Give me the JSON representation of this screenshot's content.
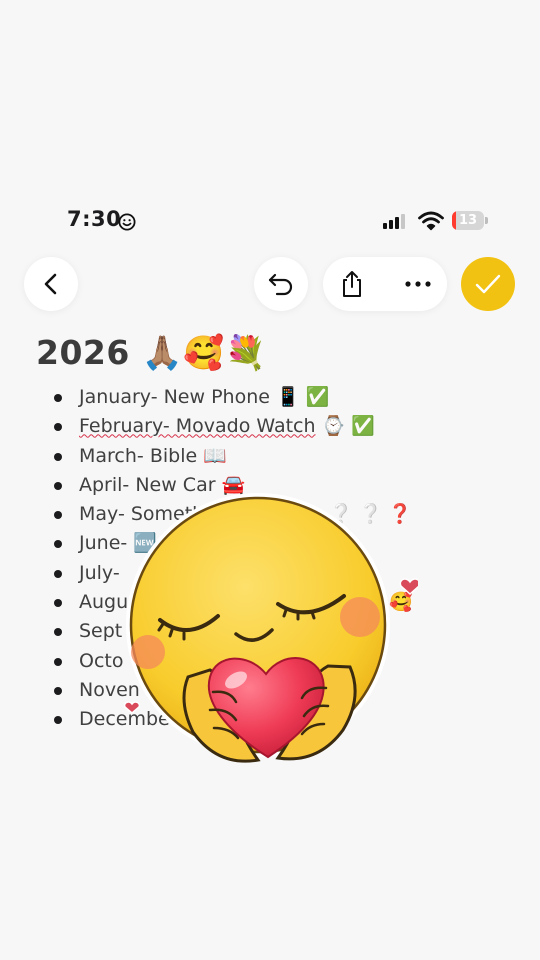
{
  "status": {
    "time": "7:30",
    "battery_level": "13",
    "battery_color": "#ff3b30",
    "signal_bars": 3,
    "icons": [
      "focus-smiley-icon",
      "cellular-signal-icon",
      "wifi-icon",
      "battery-icon"
    ]
  },
  "toolbar": {
    "icons": [
      "back-chevron-icon",
      "undo-icon",
      "share-icon",
      "more-icon",
      "checkmark-icon"
    ],
    "done_color": "#f2c212"
  },
  "note": {
    "title": "2026 🙏🏽🥰💐",
    "items": [
      {
        "text": "January- New Phone",
        "emoji": "📱 ✅"
      },
      {
        "text": "February- Movado Watch",
        "emoji": "⌚ ✅"
      },
      {
        "text": "March- Bible",
        "emoji": "📖"
      },
      {
        "text": "April- New Car",
        "emoji": "🚘"
      },
      {
        "text": "May- Someth",
        "emoji": "❔ ❔ ❓"
      },
      {
        "text": "June-",
        "emoji": "🆕"
      },
      {
        "text": "July-",
        "emoji": ""
      },
      {
        "text": "Augu",
        "emoji": "🥰"
      },
      {
        "text": "Sept",
        "emoji": ""
      },
      {
        "text": "Octo",
        "emoji": ""
      },
      {
        "text": "Noven",
        "emoji": ""
      },
      {
        "text": "Decembe",
        "emoji": ""
      }
    ]
  },
  "overlay": {
    "name": "praying-heart-emoji-sticker",
    "face_color": "#f8cc2c",
    "heart_color": "#ef3b55"
  }
}
